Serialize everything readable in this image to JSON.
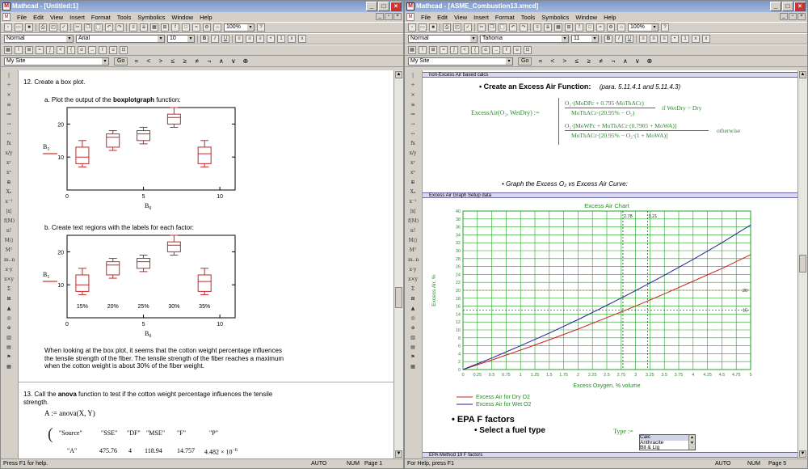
{
  "left": {
    "title": "Mathcad - [Untitled:1]",
    "menus": [
      "File",
      "Edit",
      "View",
      "Insert",
      "Format",
      "Tools",
      "Symbolics",
      "Window",
      "Help"
    ],
    "style": "Normal",
    "font": "Arial",
    "size": "10",
    "zoom": "100%",
    "site": "My Site",
    "go": "Go",
    "q12": "12.  Create a box plot.",
    "qa_pre": "a.  Plot the output of the ",
    "qa_bold": "boxplotgraph",
    "qa_post": " function:",
    "qb": "b.  Create text regions with the labels for each factor:",
    "ylabel": "B",
    "ylabel_sub": "1",
    "xlabel": "B",
    "xlabel_sub": "0",
    "yticks": [
      "20",
      "10"
    ],
    "xticks": [
      "0",
      "5",
      "10"
    ],
    "factor_labels": [
      "15%",
      "20%",
      "25%",
      "30%",
      "35%"
    ],
    "para": "When looking at the box plot, it seems that the cotton weight percentage influences the tensile strength of the fiber. The tensile strength of the fiber reaches a maximum when the cotton weight is about 30% of the fiber weight.",
    "q13_pre": "13.  Call the ",
    "q13_bold": "anova",
    "q13_post": " function to test if the cotton weight percentage influences the tensile strength.",
    "anova_expr": "A := anova(X, Y)",
    "anova_header": [
      "\"Source\"",
      "\"SSE\"",
      "\"DF\"",
      "\"MSE\"",
      "\"F\"",
      "\"P\""
    ],
    "anova_row": [
      "\"A\"",
      "475.76",
      "4",
      "118.94",
      "14.757",
      "4.482 × 10"
    ],
    "anova_exp": "−6",
    "status_left": "Press F1 for help.",
    "status_auto": "AUTO",
    "status_num": "NUM",
    "status_page": "Page 1"
  },
  "right": {
    "title": "Mathcad - [ASME_Combustion13.xmcd]",
    "menus": [
      "File",
      "Edit",
      "View",
      "Insert",
      "Format",
      "Tools",
      "Symbolics",
      "Window",
      "Help"
    ],
    "style": "Normal",
    "font": "Tahoma",
    "size": "11",
    "zoom": "100%",
    "site": "My Site",
    "go": "Go",
    "region1": "non-Excess Air based calcs",
    "heading1": "Create an Excess Air Function:",
    "heading1_ref": "(para. 5.11.4.1 and 5.11.4.3)",
    "func_lhs": "ExcessAir(O₂, WetDry) :=",
    "f1_num": "O₂·(MoDPc + 0.795·MoThACr)",
    "f1_den": "MoThACr·(20.95% − O₂)",
    "f1_cond": "if  WetDry = Dry",
    "f2_num": "O₂·[MoWPc + MoThACr·(0.7905 + MoWA)]",
    "f2_den": "MoThACr·[20.95% − O₂·(1 + MoWA)]",
    "f2_cond": "otherwise",
    "graph_bullet": "Graph the Excess O₂ vs Excess Air Curve:",
    "region2": "Excess Air Graph Setup data",
    "chart_title": "Excess Air Chart",
    "y_axis_label": "Excess Air, %",
    "x_axis_label": "Excess Oxygen, % volume",
    "legend_dry": "Excess Air for Dry O2",
    "legend_wet": "Excess Air for Wet O2",
    "marker_x1": "2.78",
    "marker_x2": "3.21",
    "marker_y1": "20",
    "marker_y2": "15",
    "epa_heading": "EPA F factors",
    "select_fuel": "Select a fuel type",
    "type_label": "Type :=",
    "fuel_options": [
      "Calc",
      "Anthracite",
      "Bit & Lig"
    ],
    "region3": "EPA Method 19 F factors",
    "status_left": "For Help, press F1",
    "status_auto": "AUTO",
    "status_num": "NUM",
    "status_page": "Page 5",
    "colors": {
      "dry": "#cc2222",
      "wet": "#222299",
      "grid": "#1fa51f",
      "text": "#2a8a2a",
      "accent": "#cc2222"
    }
  },
  "chart_data": [
    {
      "type": "box",
      "categories": [
        "15%",
        "20%",
        "25%",
        "30%",
        "35%"
      ],
      "x": [
        1,
        3,
        5,
        7,
        9
      ],
      "boxes": [
        {
          "min": 7,
          "q1": 8,
          "median": 10,
          "q3": 13,
          "max": 15
        },
        {
          "min": 12,
          "q1": 13,
          "median": 16,
          "q3": 17,
          "max": 18
        },
        {
          "min": 14,
          "q1": 15,
          "median": 17,
          "q3": 18,
          "max": 19
        },
        {
          "min": 19,
          "q1": 20,
          "median": 22,
          "q3": 23,
          "max": 25
        },
        {
          "min": 7,
          "q1": 8,
          "median": 11,
          "q3": 13,
          "max": 15
        }
      ],
      "xlim": [
        0,
        11
      ],
      "ylim": [
        0,
        25
      ],
      "xlabel": "B0",
      "ylabel": "B1"
    },
    {
      "type": "line",
      "title": "Excess Air Chart",
      "xlabel": "Excess Oxygen, % volume",
      "ylabel": "Excess Air, %",
      "xlim": [
        0,
        5
      ],
      "ylim": [
        0,
        40
      ],
      "x": [
        0,
        0.5,
        1,
        1.5,
        2,
        2.5,
        3,
        3.5,
        4,
        4.5,
        5
      ],
      "series": [
        {
          "name": "Excess Air for Dry O2",
          "values": [
            0,
            2.4,
            4.9,
            7.5,
            10.2,
            13.1,
            16.0,
            19.1,
            22.3,
            25.5,
            29.0
          ]
        },
        {
          "name": "Excess Air for Wet O2",
          "values": [
            0,
            2.9,
            6.0,
            9.2,
            12.6,
            16.2,
            19.9,
            23.8,
            27.8,
            32.0,
            36.5
          ]
        }
      ],
      "markers": {
        "x": [
          2.78,
          3.21
        ],
        "y": [
          20,
          15
        ]
      },
      "grid": true
    }
  ]
}
